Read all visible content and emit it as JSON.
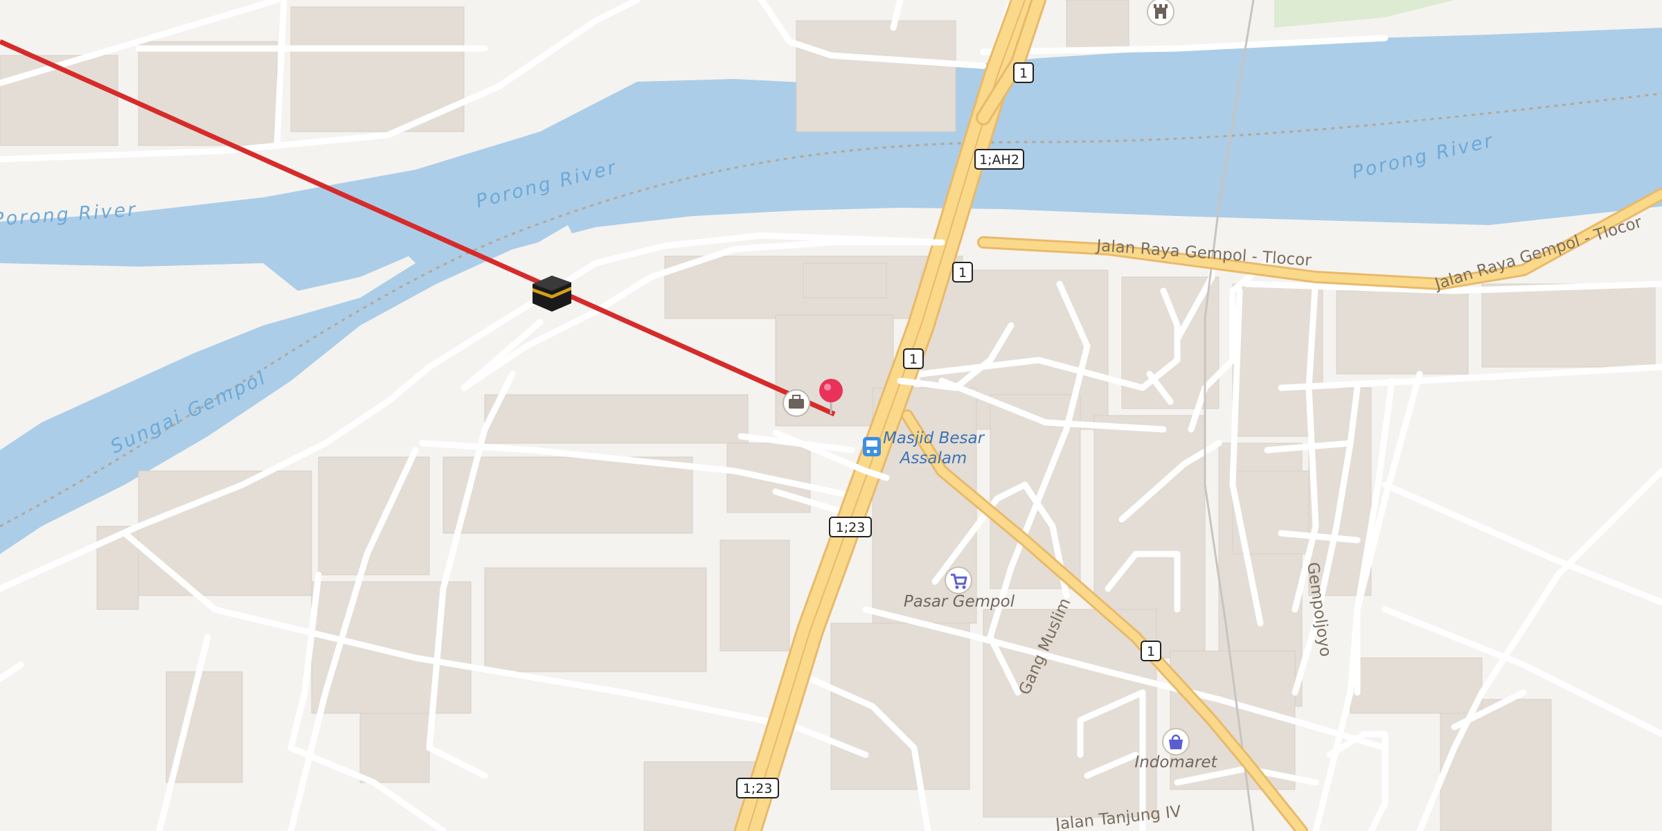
{
  "map": {
    "water_labels": [
      {
        "text": "Porong River"
      },
      {
        "text": "Porong River"
      },
      {
        "text": "Porong River"
      },
      {
        "text": "Sungai Gempol"
      }
    ],
    "street_labels": [
      {
        "text": "Jalan Raya Gempol - Tlocor"
      },
      {
        "text": "Jalan Raya Gempol - Tlocor"
      },
      {
        "text": "Gang Muslim"
      },
      {
        "text": "Gempoljoyo"
      },
      {
        "text": "Jalan Tanjung IV"
      }
    ],
    "route_shields": [
      "1",
      "1;AH2",
      "1",
      "1",
      "1;23",
      "1",
      "1;23"
    ],
    "pois": {
      "mosque_line1": "Masjid Besar",
      "mosque_line2": "Assalam",
      "market": "Pasar Gempol",
      "store": "Indomaret"
    },
    "colors": {
      "water": "#abcde8",
      "land": "#f5f3f0",
      "building": "#e3ddd5",
      "trunk_road": "#fad98b",
      "trunk_casing": "#e9b96a",
      "qibla_line": "#d62b2b",
      "pin": "#e8325a",
      "poi_blue": "#3d73b4",
      "park": "#dcebd2"
    },
    "icons": [
      "kaaba-icon",
      "map-pin-icon",
      "bus-stop-icon",
      "shopping-cart-icon",
      "shopping-bag-icon",
      "castle-icon",
      "luggage-icon"
    ]
  }
}
